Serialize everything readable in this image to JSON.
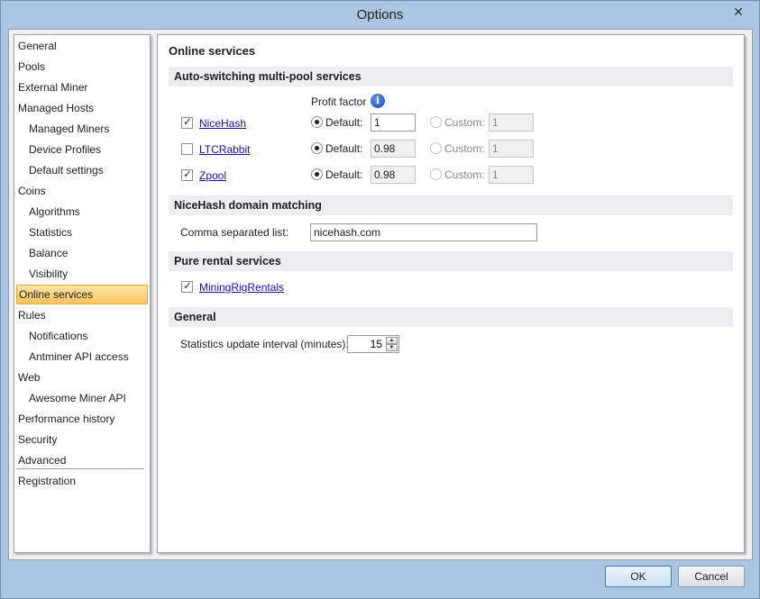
{
  "window": {
    "title": "Options",
    "close_glyph": "✕"
  },
  "sidebar": {
    "items": [
      {
        "label": "General",
        "sub": false,
        "active": false
      },
      {
        "label": "Pools",
        "sub": false,
        "active": false
      },
      {
        "label": "External Miner",
        "sub": false,
        "active": false
      },
      {
        "label": "Managed Hosts",
        "sub": false,
        "active": false
      },
      {
        "label": "Managed Miners",
        "sub": true,
        "active": false
      },
      {
        "label": "Device Profiles",
        "sub": true,
        "active": false
      },
      {
        "label": "Default settings",
        "sub": true,
        "active": false
      },
      {
        "label": "Coins",
        "sub": false,
        "active": false
      },
      {
        "label": "Algorithms",
        "sub": true,
        "active": false
      },
      {
        "label": "Statistics",
        "sub": true,
        "active": false
      },
      {
        "label": "Balance",
        "sub": true,
        "active": false
      },
      {
        "label": "Visibility",
        "sub": true,
        "active": false
      },
      {
        "label": "Online services",
        "sub": false,
        "active": true
      },
      {
        "label": "Rules",
        "sub": false,
        "active": false
      },
      {
        "label": "Notifications",
        "sub": true,
        "active": false
      },
      {
        "label": "Antminer API access",
        "sub": true,
        "active": false
      },
      {
        "label": "Web",
        "sub": false,
        "active": false
      },
      {
        "label": "Awesome Miner API",
        "sub": true,
        "active": false
      },
      {
        "label": "Performance history",
        "sub": false,
        "active": false
      },
      {
        "label": "Security",
        "sub": false,
        "active": false
      },
      {
        "label": "Advanced",
        "sub": false,
        "active": false
      },
      {
        "label": "Registration",
        "sub": false,
        "active": false
      }
    ]
  },
  "panel": {
    "title": "Online services",
    "auto_switching": {
      "header": "Auto-switching multi-pool services",
      "profit_factor_label": "Profit factor",
      "info_icon_glyph": "i",
      "default_label": "Default:",
      "custom_label": "Custom:",
      "services": [
        {
          "name": "NiceHash",
          "checked": true,
          "default_value": "1",
          "custom_value": "1"
        },
        {
          "name": "LTCRabbit",
          "checked": false,
          "default_value": "0.98",
          "custom_value": "1"
        },
        {
          "name": "Zpool",
          "checked": true,
          "default_value": "0.98",
          "custom_value": "1"
        }
      ]
    },
    "domain_matching": {
      "header": "NiceHash domain matching",
      "label": "Comma separated list:",
      "value": "nicehash.com"
    },
    "rental": {
      "header": "Pure rental services",
      "services": [
        {
          "name": "MiningRigRentals",
          "checked": true
        }
      ]
    },
    "general": {
      "header": "General",
      "interval_label": "Statistics update interval (minutes):",
      "interval_value": "15",
      "up_glyph": "▲",
      "down_glyph": "▼"
    }
  },
  "footer": {
    "ok_label": "OK",
    "cancel_label": "Cancel"
  }
}
